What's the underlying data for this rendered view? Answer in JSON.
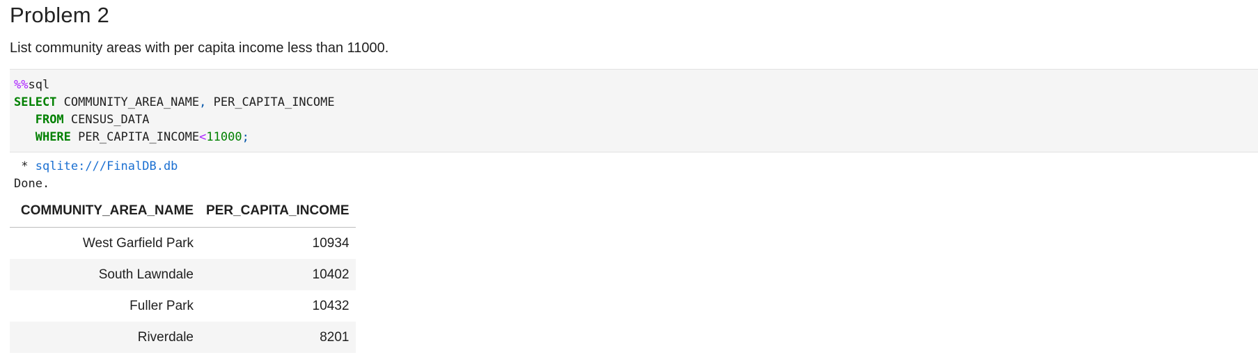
{
  "markdown": {
    "heading": "Problem 2",
    "description": "List community areas with per capita income less than 11000."
  },
  "code": {
    "magic": "%%",
    "magic_name": "sql",
    "line1_select": "SELECT",
    "line1_col1": " COMMUNITY_AREA_NAME",
    "line1_comma": ",",
    "line1_col2": " PER_CAPITA_INCOME",
    "line2_indent": "   ",
    "line2_from": "FROM",
    "line2_table": " CENSUS_DATA",
    "line3_indent": "   ",
    "line3_where": "WHERE",
    "line3_col": " PER_CAPITA_INCOME",
    "line3_op": "<",
    "line3_value": "11000",
    "line3_semicolon": ";"
  },
  "output": {
    "conn_prefix": " * ",
    "connection": "sqlite:///FinalDB.db",
    "status": "Done."
  },
  "table": {
    "headers": [
      "COMMUNITY_AREA_NAME",
      "PER_CAPITA_INCOME"
    ],
    "rows": [
      [
        "West Garfield Park",
        "10934"
      ],
      [
        "South Lawndale",
        "10402"
      ],
      [
        "Fuller Park",
        "10432"
      ],
      [
        "Riverdale",
        "8201"
      ]
    ]
  },
  "colors": {
    "keyword": "#008000",
    "magic": "#aa22ff",
    "link": "#1a6fd1",
    "code_background": "#f5f5f5"
  }
}
